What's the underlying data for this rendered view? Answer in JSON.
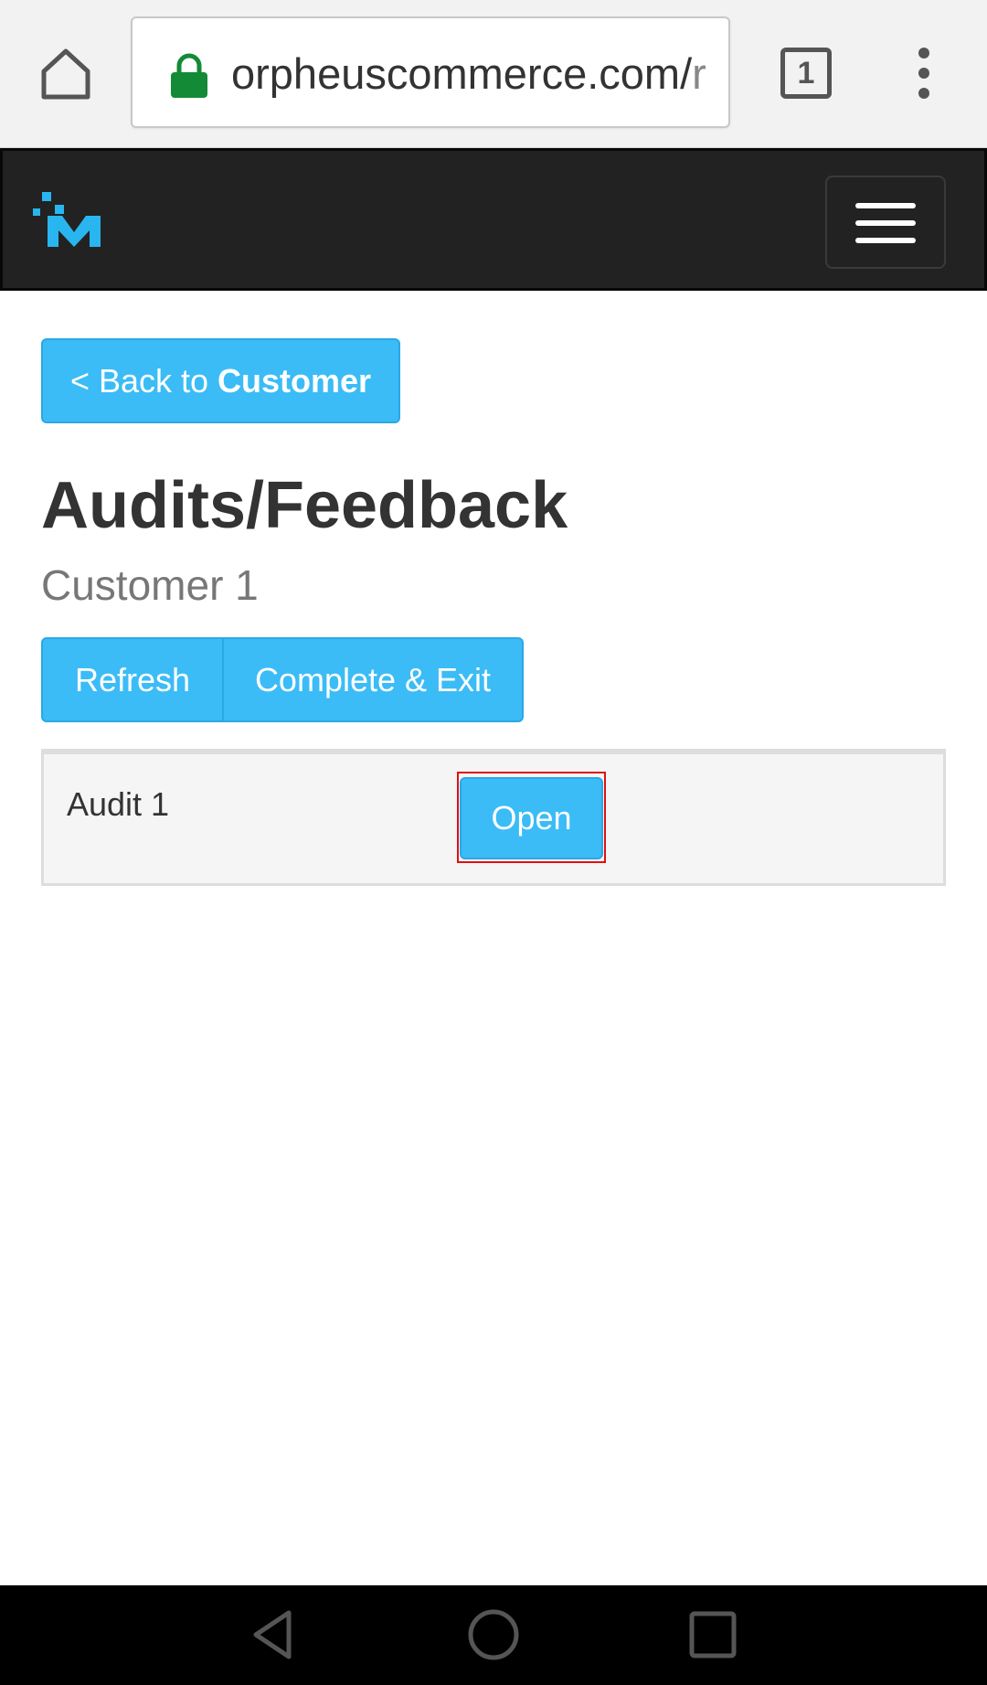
{
  "browser": {
    "url_main": "orpheuscommerce.com/",
    "url_dim": "r",
    "tab_count": "1"
  },
  "header": {
    "logo_text": "M"
  },
  "main": {
    "back_button": {
      "prefix": "< Back to ",
      "bold": "Customer"
    },
    "title": "Audits/Feedback",
    "subtitle": "Customer 1",
    "actions": {
      "refresh": "Refresh",
      "complete": "Complete & Exit"
    },
    "audits": [
      {
        "label": "Audit 1",
        "button": "Open"
      }
    ]
  },
  "colors": {
    "accent": "#3bbcf6",
    "navbar": "#222222",
    "highlight": "#e01010"
  },
  "icons": [
    "home-icon",
    "lock-icon",
    "tabs-icon",
    "more-vert-icon",
    "menu-icon",
    "back-nav-icon",
    "home-nav-icon",
    "recents-nav-icon"
  ]
}
